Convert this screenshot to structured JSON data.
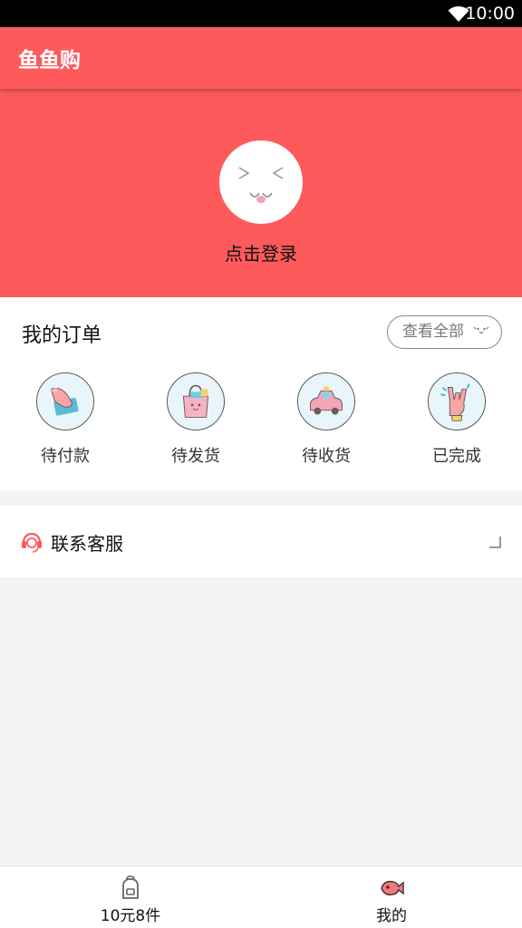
{
  "status_bar": {
    "time": "10:00",
    "wifi_icon": "wifi-icon"
  },
  "app_bar": {
    "title": "鱼鱼购"
  },
  "profile": {
    "avatar_icon": "avatar-face-icon",
    "login_text": "点击登录"
  },
  "orders": {
    "title": "我的订单",
    "view_all_label": "查看全部",
    "items": [
      {
        "label": "待付款",
        "icon": "payment-hand-icon"
      },
      {
        "label": "待发货",
        "icon": "shopping-bag-icon"
      },
      {
        "label": "待收货",
        "icon": "delivery-car-icon"
      },
      {
        "label": "已完成",
        "icon": "rock-hand-icon"
      }
    ]
  },
  "service": {
    "label": "联系客服",
    "icon": "headset-icon"
  },
  "bottom_nav": {
    "items": [
      {
        "label": "10元8件",
        "icon": "backpack-icon"
      },
      {
        "label": "我的",
        "icon": "fish-icon",
        "active": true
      }
    ]
  },
  "colors": {
    "primary": "#fe5a5c",
    "background": "#f4f4f4"
  }
}
